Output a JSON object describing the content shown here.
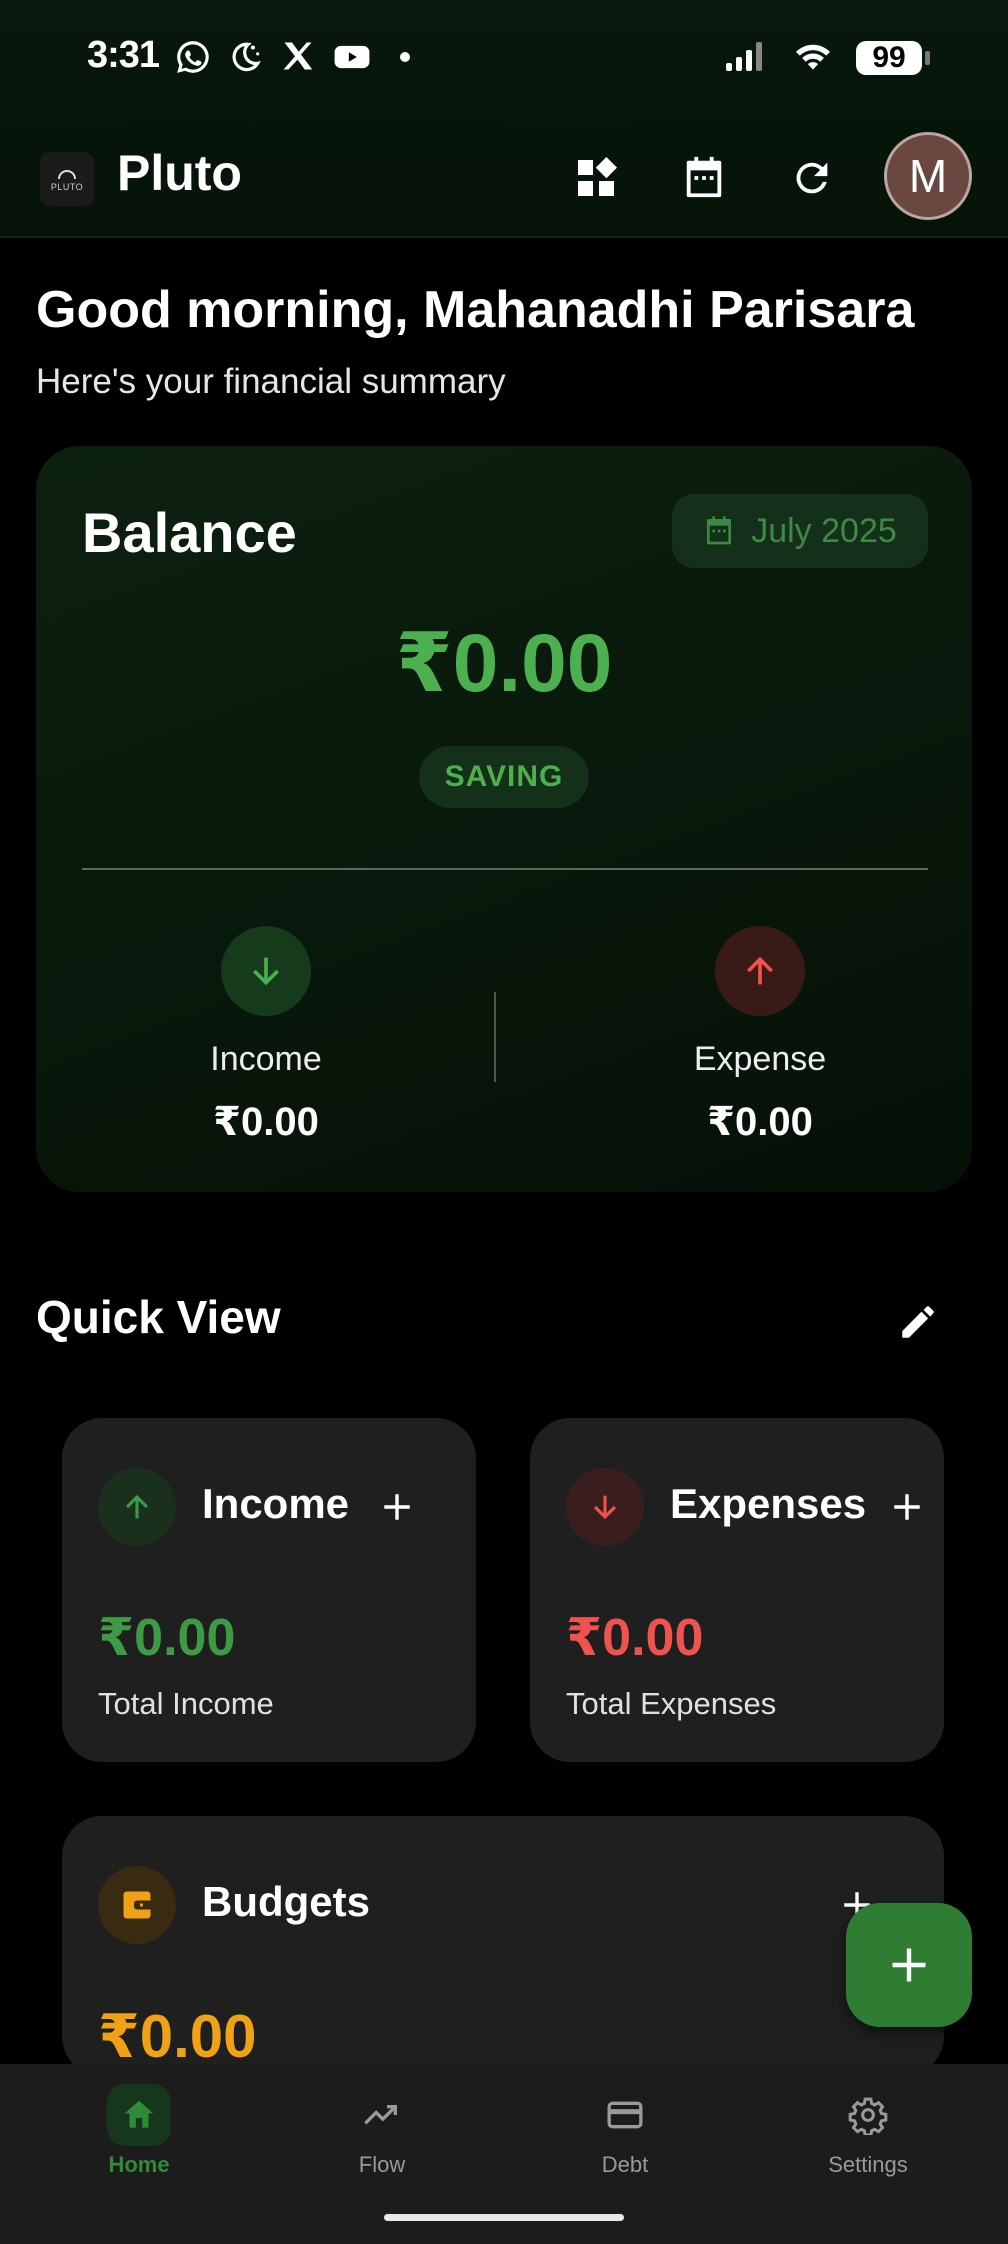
{
  "status_bar": {
    "time": "3:31",
    "battery": "99",
    "notification_icons": [
      "whatsapp-icon",
      "moon-icon",
      "x-icon",
      "youtube-icon",
      "dot-icon"
    ],
    "system_icons": [
      "signal-icon",
      "wifi-icon",
      "battery-icon"
    ]
  },
  "app_bar": {
    "logo_text": "PLUTO",
    "title": "Pluto",
    "actions": [
      "dashboard-icon",
      "calendar-icon",
      "refresh-icon"
    ],
    "avatar_initial": "M"
  },
  "header": {
    "greeting": "Good morning, Mahanadhi Parisara",
    "subtitle": "Here's your financial summary"
  },
  "balance_card": {
    "title": "Balance",
    "month": "July 2025",
    "amount": "₹0.00",
    "status": "SAVING",
    "income_label": "Income",
    "income_value": "₹0.00",
    "expense_label": "Expense",
    "expense_value": "₹0.00"
  },
  "quick_view": {
    "title": "Quick View",
    "cards": [
      {
        "title": "Income",
        "amount": "₹0.00",
        "label": "Total Income",
        "color": "#4caf50"
      },
      {
        "title": "Expenses",
        "amount": "₹0.00",
        "label": "Total Expenses",
        "color": "#ef5350"
      }
    ],
    "budgets": {
      "title": "Budgets",
      "amount": "₹0.00",
      "color": "#f0a117"
    }
  },
  "bottom_nav": {
    "items": [
      {
        "label": "Home",
        "icon": "home-icon",
        "active": true
      },
      {
        "label": "Flow",
        "icon": "trending-up-icon",
        "active": false
      },
      {
        "label": "Debt",
        "icon": "credit-card-icon",
        "active": false
      },
      {
        "label": "Settings",
        "icon": "settings-icon",
        "active": false
      }
    ]
  },
  "colors": {
    "accent_green": "#4caf50",
    "fab_green": "#2e7d32",
    "expense_red": "#ef5350",
    "budget_orange": "#f0a117"
  }
}
